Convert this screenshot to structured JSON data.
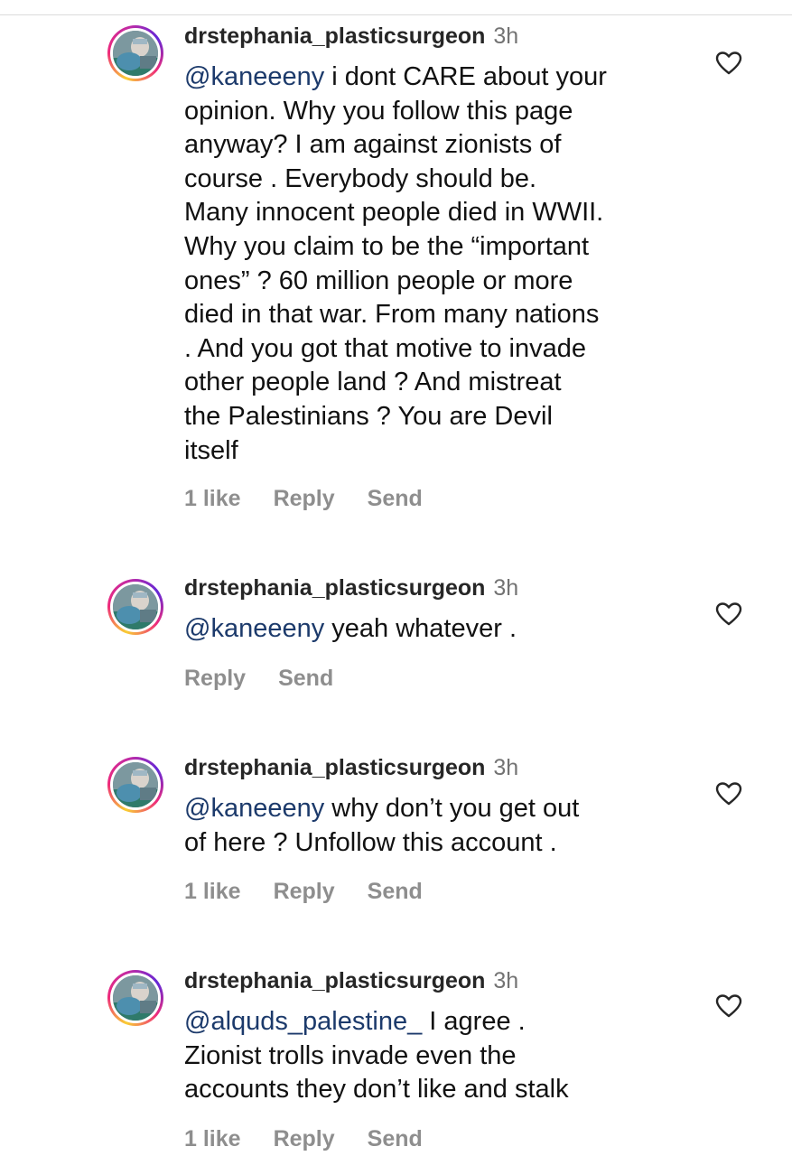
{
  "comments": [
    {
      "username": "drstephania_plasticsurgeon",
      "time": "3h",
      "mention": "@kaneeeny",
      "text": " i dont CARE about your\nopinion. Why you follow this page\nanyway? I am against zionists of\ncourse . Everybody should be.\nMany innocent people died in WWII.\nWhy you claim to be the “important\nones” ? 60 million people or more\ndied in that war. From many nations\n. And you got that motive to invade\nother people land ? And mistreat\nthe Palestinians ? You are Devil\nitself",
      "likes": "1 like",
      "reply": "Reply",
      "send": "Send",
      "like_icon": "heart-outline-icon"
    },
    {
      "username": "drstephania_plasticsurgeon",
      "time": "3h",
      "mention": "@kaneeeny",
      "text": " yeah whatever .",
      "likes": "",
      "reply": "Reply",
      "send": "Send",
      "like_icon": "heart-outline-icon"
    },
    {
      "username": "drstephania_plasticsurgeon",
      "time": "3h",
      "mention": "@kaneeeny",
      "text": " why don’t you get out\nof here ? Unfollow this account .",
      "likes": "1 like",
      "reply": "Reply",
      "send": "Send",
      "like_icon": "heart-outline-icon"
    },
    {
      "username": "drstephania_plasticsurgeon",
      "time": "3h",
      "mention": "@alquds_palestine_",
      "text": " I agree .\nZionist trolls invade even the\naccounts they don’t like and stalk",
      "likes": "1 like",
      "reply": "Reply",
      "send": "Send",
      "like_icon": "heart-outline-icon"
    }
  ],
  "colors": {
    "mention": "#1c3a6b",
    "username": "#262626",
    "secondary": "#8e8e8e",
    "time": "#737373"
  }
}
